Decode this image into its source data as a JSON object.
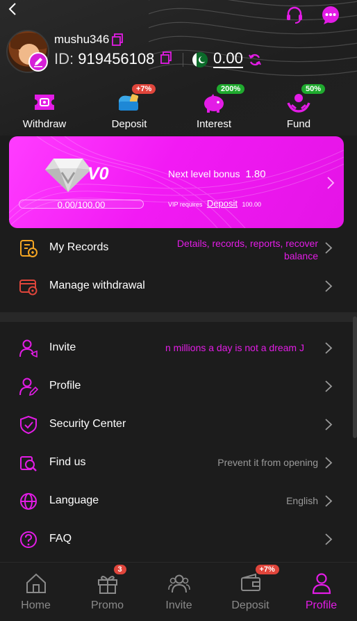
{
  "header": {
    "username": "mushu346",
    "id_label": "ID:",
    "id_value": "919456108",
    "balance": "0.00"
  },
  "quick_actions": [
    {
      "label": "Withdraw",
      "badge": ""
    },
    {
      "label": "Deposit",
      "badge": "+7%"
    },
    {
      "label": "Interest",
      "badge": "200%"
    },
    {
      "label": "Fund",
      "badge": "50%"
    }
  ],
  "vip": {
    "level": "V0",
    "progress_text": "0.00/100.00",
    "progress_fraction": 0,
    "next_bonus_label": "Next level bonus",
    "next_bonus_value": "1.80",
    "requires_label": "VIP requires",
    "requires_link": "Deposit",
    "requires_value": "100.00"
  },
  "menu_top": [
    {
      "label": "My Records",
      "value": "Details, records, reports, recover balance"
    },
    {
      "label": "Manage withdrawal",
      "value": ""
    }
  ],
  "menu_main": [
    {
      "label": "Invite",
      "value": "n millions a day is not a dream  J"
    },
    {
      "label": "Profile",
      "value": ""
    },
    {
      "label": "Security Center",
      "value": ""
    },
    {
      "label": "Find us",
      "value": "Prevent it from opening"
    },
    {
      "label": "Language",
      "value": "English"
    },
    {
      "label": "FAQ",
      "value": ""
    }
  ],
  "tabbar": [
    {
      "label": "Home",
      "badge": ""
    },
    {
      "label": "Promo",
      "badge": "3"
    },
    {
      "label": "Invite",
      "badge": ""
    },
    {
      "label": "Deposit",
      "badge": "+7%"
    },
    {
      "label": "Profile",
      "badge": ""
    }
  ],
  "colors": {
    "accent": "#e31ce6",
    "badge_red": "#e0453b",
    "badge_green": "#1faa2e"
  }
}
